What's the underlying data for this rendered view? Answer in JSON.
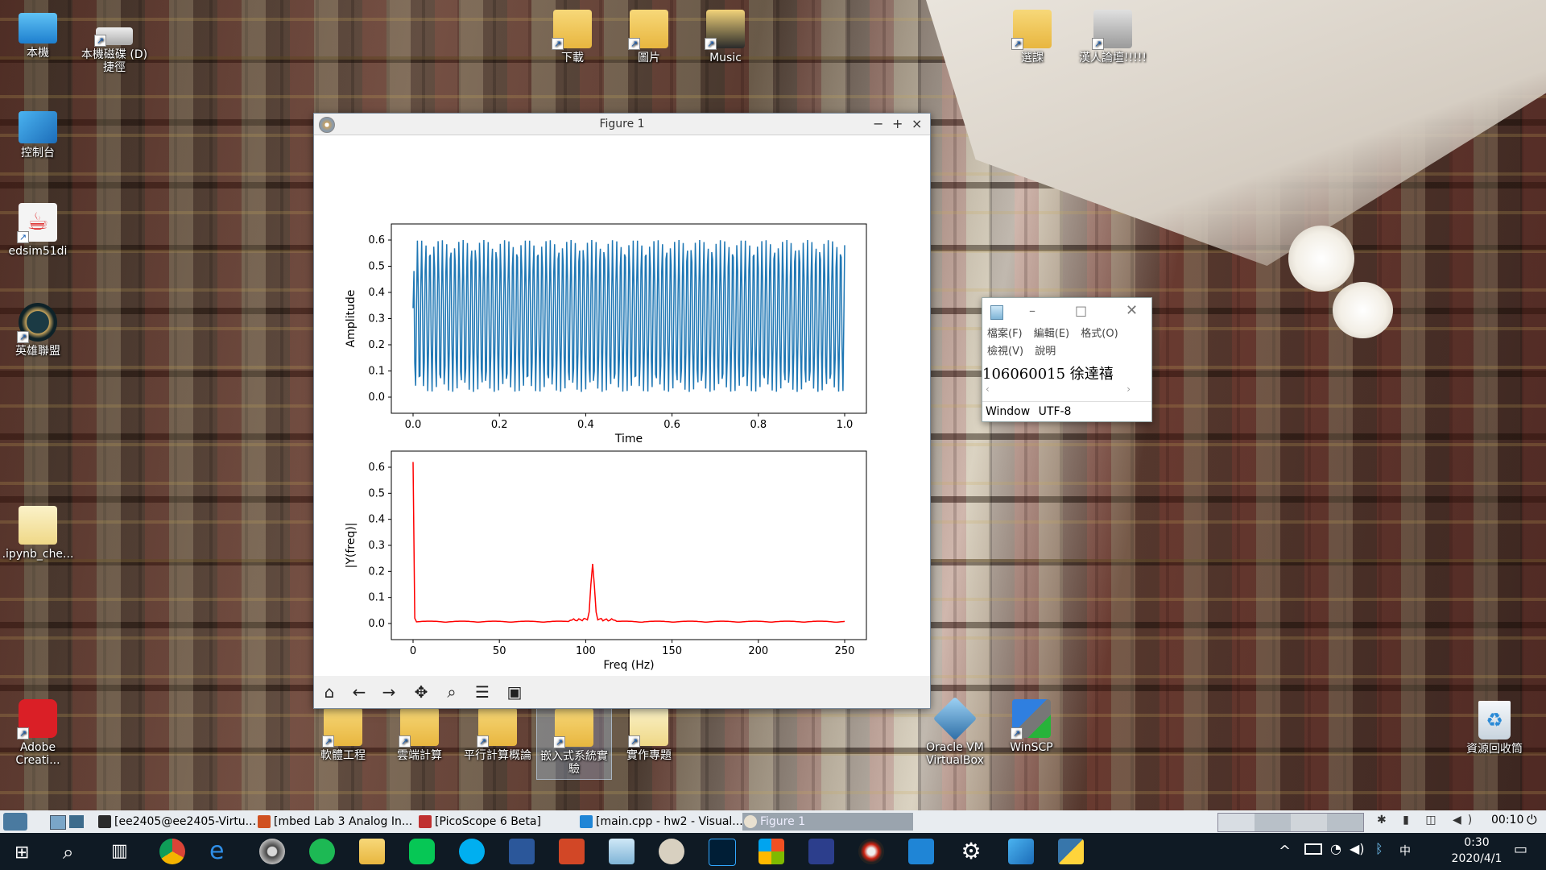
{
  "desktop": {
    "icons_left": [
      {
        "label": "本機",
        "icon": "computer-icon"
      },
      {
        "label": "本機磁碟 (D)\n捷徑",
        "icon": "drive-icon"
      },
      {
        "label": "控制台",
        "icon": "control-panel-icon"
      },
      {
        "label": "edsim51di",
        "icon": "java-icon"
      },
      {
        "label": "英雄聯盟",
        "icon": "league-of-legends-icon"
      },
      {
        "label": ".ipynb_che...",
        "icon": "folder-icon"
      },
      {
        "label": "Adobe\nCreati...",
        "icon": "adobe-cc-icon"
      }
    ],
    "icons_top": [
      {
        "label": "下載",
        "icon": "download-folder-icon"
      },
      {
        "label": "圖片",
        "icon": "pictures-folder-icon"
      },
      {
        "label": "Music",
        "icon": "music-folder-icon"
      },
      {
        "label": "選課",
        "icon": "folder-icon"
      },
      {
        "label": "漢人論壇!!!!!",
        "icon": "folder-icon"
      }
    ],
    "icons_bottom": [
      {
        "label": "軟體工程",
        "icon": "folder-icon"
      },
      {
        "label": "雲端計算",
        "icon": "folder-icon"
      },
      {
        "label": "平行計算概論",
        "icon": "folder-icon"
      },
      {
        "label": "嵌入式系統實\n驗",
        "icon": "folder-icon"
      },
      {
        "label": "實作專題",
        "icon": "folder-icon"
      },
      {
        "label": "Oracle VM\nVirtualBox",
        "icon": "virtualbox-icon"
      },
      {
        "label": "WinSCP",
        "icon": "winscp-icon"
      },
      {
        "label": "資源回收筒",
        "icon": "recycle-bin-icon"
      }
    ]
  },
  "figure": {
    "title": "Figure 1",
    "controls": {
      "min": "−",
      "max": "+",
      "close": "×"
    },
    "toolbar": [
      "home-icon",
      "back-icon",
      "forward-icon",
      "pan-icon",
      "zoom-icon",
      "configure-icon",
      "save-icon"
    ]
  },
  "chart_data": [
    {
      "type": "line",
      "xlabel": "Time",
      "ylabel": "Amplitude",
      "xlim": [
        0.0,
        1.0
      ],
      "ylim": [
        0.0,
        0.6
      ],
      "xticks": [
        "0.0",
        "0.2",
        "0.4",
        "0.6",
        "0.8",
        "1.0"
      ],
      "yticks": [
        "0.0",
        "0.1",
        "0.2",
        "0.3",
        "0.4",
        "0.5",
        "0.6"
      ],
      "color": "#1f77b4",
      "sample_rate_hz": 500,
      "signal": {
        "offset": 0.31,
        "amplitude": 0.29,
        "frequency_hz": 104,
        "duration_s": 1.0,
        "start_value": 0.34
      }
    },
    {
      "type": "line",
      "xlabel": "Freq (Hz)",
      "ylabel": "|Y(freq)|",
      "xlim": [
        0,
        250
      ],
      "ylim": [
        0.0,
        0.6
      ],
      "xticks": [
        "0",
        "50",
        "100",
        "150",
        "200",
        "250"
      ],
      "yticks": [
        "0.0",
        "0.1",
        "0.2",
        "0.3",
        "0.4",
        "0.5",
        "0.6"
      ],
      "color": "#ff0000",
      "peaks": [
        {
          "freq": 0,
          "value": 0.62
        },
        {
          "freq": 104,
          "value": 0.22
        }
      ]
    }
  ],
  "notepad": {
    "menu": [
      "檔案(F)",
      "編輯(E)",
      "格式(O)",
      "檢視(V)",
      "說明"
    ],
    "text": "106060015 徐達禧",
    "status_left": "Window",
    "status_right": "UTF-8"
  },
  "taskbar_top": {
    "tasks": [
      "[ee2405@ee2405-Virtu...",
      "[mbed Lab 3 Analog In...",
      "[PicoScope 6 Beta]",
      "[main.cpp - hw2 - Visual...",
      "Figure 1"
    ],
    "clock": "00:10"
  },
  "taskbar": {
    "time": "0:30",
    "date": "2020/4/1",
    "ime": "中"
  }
}
